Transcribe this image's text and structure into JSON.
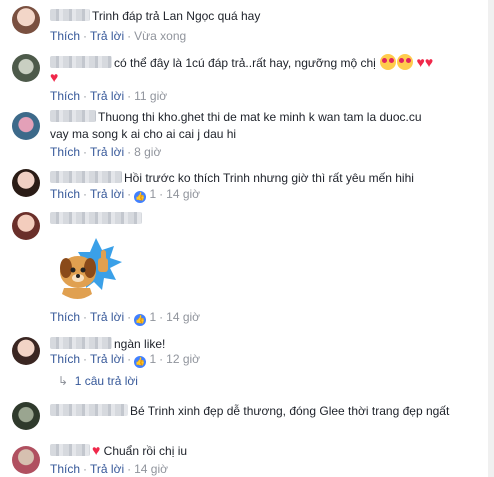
{
  "comments": [
    {
      "text": "Trinh đáp trả Lan Ngọc quá hay",
      "like": "Thích",
      "reply": "Trả lời",
      "time": "Vừa xong",
      "likes": ""
    },
    {
      "text": "có thể đây là 1cú đáp trả..rất hay, ngưỡng mộ chị",
      "like": "Thích",
      "reply": "Trả lời",
      "time": "11 giờ",
      "likes": ""
    },
    {
      "text1": "Thuong thi kho.ghet thi de mat ke minh k wan tam la duoc.cu",
      "text2": "vay ma song k ai cho ai cai j dau hi",
      "like": "Thích",
      "reply": "Trả lời",
      "time": "8 giờ",
      "likes": ""
    },
    {
      "text": "Hồi trước ko thích Trinh nhưng giờ thì rất yêu mến hihi",
      "like": "Thích",
      "reply": "Trả lời",
      "time": "14 giờ",
      "likes": "1"
    },
    {
      "text": "",
      "like": "Thích",
      "reply": "Trả lời",
      "time": "14 giờ",
      "likes": "1"
    },
    {
      "text": "ngàn like!",
      "like": "Thích",
      "reply": "Trả lời",
      "time": "12 giờ",
      "likes": "1",
      "replies": "1 câu trả lời"
    },
    {
      "text": "Bé Trinh xinh đẹp dễ thương, đóng Glee thời trang đẹp ngất",
      "like": "",
      "reply": "",
      "time": "",
      "likes": ""
    },
    {
      "text": "Chuẩn rồi chị iu",
      "like": "Thích",
      "reply": "Trả lời",
      "time": "14 giờ",
      "likes": ""
    }
  ]
}
